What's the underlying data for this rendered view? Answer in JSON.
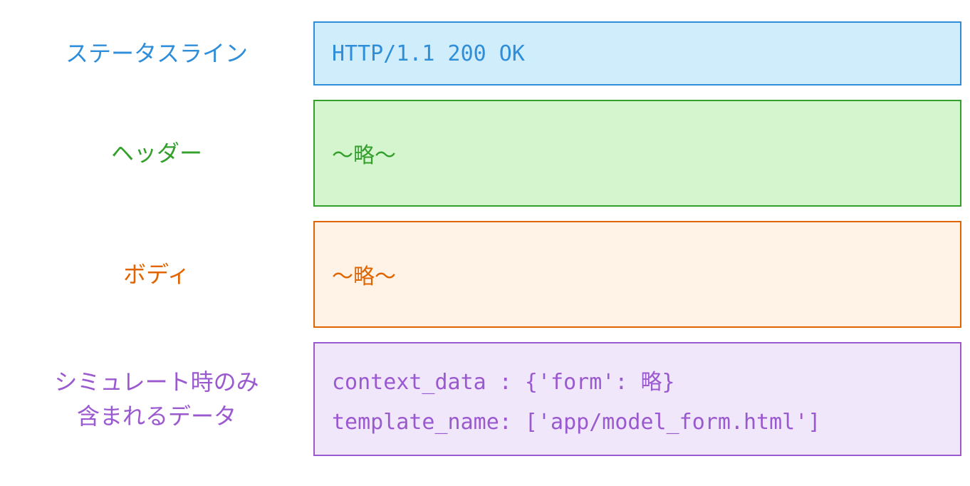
{
  "status": {
    "label": "ステータスライン",
    "content": "HTTP/1.1 200 OK"
  },
  "header": {
    "label": "ヘッダー",
    "content": "〜略〜"
  },
  "body": {
    "label": "ボディ",
    "content": "〜略〜"
  },
  "sim": {
    "label_line1": "シミュレート時のみ",
    "label_line2": "含まれるデータ",
    "line1": "context_data : {'form': 略}",
    "line2": "template_name: ['app/model_form.html']"
  }
}
